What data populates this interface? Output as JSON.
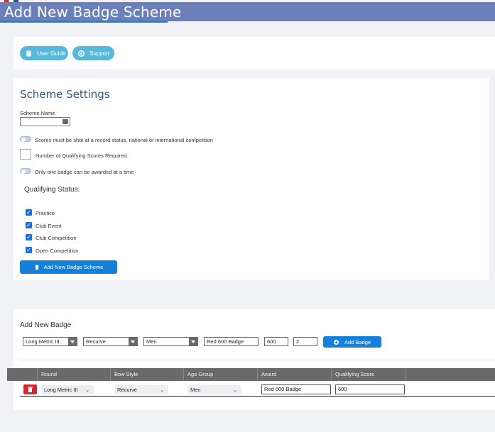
{
  "header": {
    "title": "Add New Badge Scheme"
  },
  "toolbar": {
    "user_guide_label": "User Guide",
    "support_label": "Support"
  },
  "settings": {
    "heading": "Scheme Settings",
    "scheme_name_label": "Scheme Name",
    "scheme_name_value": "",
    "record_status_toggle_label": "Scores must be shot at a record status, national or international competition",
    "qualifying_count_value": "",
    "qualifying_count_label": "Number of Qualifying Scores Required",
    "one_badge_toggle_label": "Only one badge can be awarded at a time",
    "qualifying_status_heading": "Qualifying Status:",
    "statuses": [
      {
        "label": "Practice",
        "checked": true
      },
      {
        "label": "Club Event",
        "checked": true
      },
      {
        "label": "Club Competition",
        "checked": true
      },
      {
        "label": "Open Competition",
        "checked": true
      }
    ],
    "add_scheme_label": "Add New Badge Scheme"
  },
  "add_badge": {
    "heading": "Add New Badge",
    "round_value": "Long Metric III",
    "bow_style_value": "Recurve",
    "age_group_value": "Men",
    "award_value": "Red 600 Badge",
    "score_value": "600",
    "count_value": "2",
    "add_badge_label": "Add Badge"
  },
  "table": {
    "columns": [
      "Round",
      "Bow Style",
      "Age Group",
      "Award",
      "Qualifying Score"
    ],
    "rows": [
      {
        "round": "Long Metric III",
        "bow_style": "Recurve",
        "age_group": "Men",
        "award": "Red 600 Badge",
        "score": "600"
      }
    ]
  },
  "colors": {
    "header": "#6b7fba",
    "accent": "#1e88d9",
    "pill": "#57b8d9",
    "primary_button": "#1580d8",
    "delete": "#d9262e"
  }
}
